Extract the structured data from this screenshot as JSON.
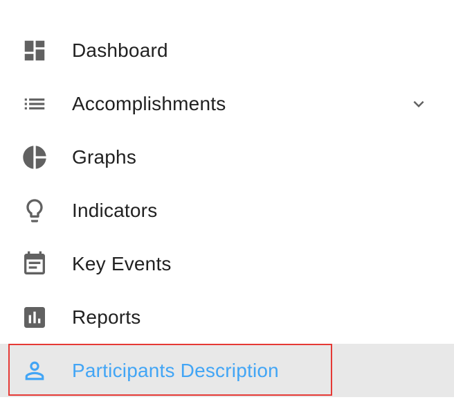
{
  "nav": {
    "items": [
      {
        "label": "Dashboard",
        "icon": "dashboard-icon"
      },
      {
        "label": "Accomplishments",
        "icon": "list-icon",
        "expand_icon": "chevron-down-icon"
      },
      {
        "label": "Graphs",
        "icon": "pie-chart-icon"
      },
      {
        "label": "Indicators",
        "icon": "lightbulb-icon"
      },
      {
        "label": "Key Events",
        "icon": "calendar-icon"
      },
      {
        "label": "Reports",
        "icon": "bar-chart-icon"
      },
      {
        "label": "Participants Description",
        "icon": "person-icon",
        "active": true
      }
    ]
  },
  "colors": {
    "icon": "#616161",
    "text": "#212121",
    "active_text": "#42a5f5",
    "active_bg": "#e8e8e8",
    "highlight_border": "#e53935"
  }
}
